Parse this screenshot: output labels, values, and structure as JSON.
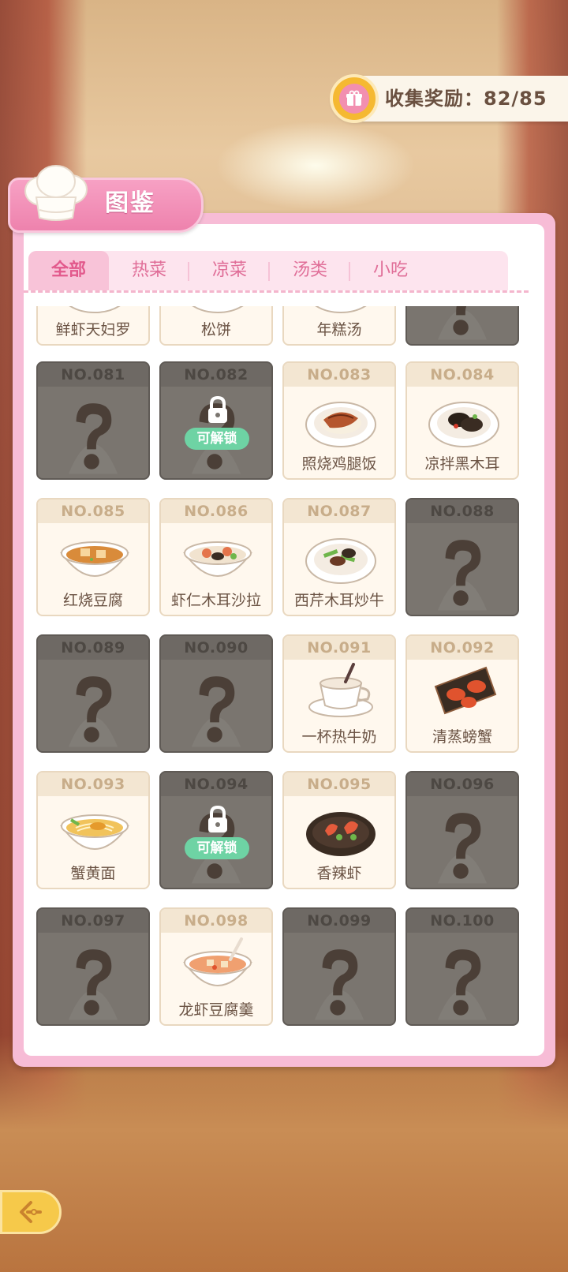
{
  "reward": {
    "label": "收集奖励：82/85",
    "icon": "gift-icon"
  },
  "title": "图鉴",
  "tabs": [
    "全部",
    "热菜",
    "凉菜",
    "汤类",
    "小吃"
  ],
  "active_tab": "全部",
  "top_row": [
    {
      "name": "鲜虾天妇罗",
      "locked": false
    },
    {
      "name": "松饼",
      "locked": false
    },
    {
      "name": "年糕汤",
      "locked": false
    },
    {
      "name": "",
      "locked": true
    }
  ],
  "cards": [
    {
      "no": "NO.081",
      "name": "",
      "locked": true,
      "unlockable": false
    },
    {
      "no": "NO.082",
      "name": "",
      "locked": true,
      "unlockable": true,
      "badge": "可解锁"
    },
    {
      "no": "NO.083",
      "name": "照烧鸡腿饭",
      "locked": false,
      "dish": "chicken-rice"
    },
    {
      "no": "NO.084",
      "name": "凉拌黑木耳",
      "locked": false,
      "dish": "fungus"
    },
    {
      "no": "NO.085",
      "name": "红烧豆腐",
      "locked": false,
      "dish": "tofu"
    },
    {
      "no": "NO.086",
      "name": "虾仁木耳沙拉",
      "locked": false,
      "dish": "salad"
    },
    {
      "no": "NO.087",
      "name": "西芹木耳炒牛",
      "locked": false,
      "dish": "beef"
    },
    {
      "no": "NO.088",
      "name": "",
      "locked": true,
      "unlockable": false
    },
    {
      "no": "NO.089",
      "name": "",
      "locked": true,
      "unlockable": false
    },
    {
      "no": "NO.090",
      "name": "",
      "locked": true,
      "unlockable": false
    },
    {
      "no": "NO.091",
      "name": "一杯热牛奶",
      "locked": false,
      "dish": "milk"
    },
    {
      "no": "NO.092",
      "name": "清蒸螃蟹",
      "locked": false,
      "dish": "crab"
    },
    {
      "no": "NO.093",
      "name": "蟹黄面",
      "locked": false,
      "dish": "noodle"
    },
    {
      "no": "NO.094",
      "name": "",
      "locked": true,
      "unlockable": true,
      "badge": "可解锁"
    },
    {
      "no": "NO.095",
      "name": "香辣虾",
      "locked": false,
      "dish": "shrimp"
    },
    {
      "no": "NO.096",
      "name": "",
      "locked": true,
      "unlockable": false
    },
    {
      "no": "NO.097",
      "name": "",
      "locked": true,
      "unlockable": false
    },
    {
      "no": "NO.098",
      "name": "龙虾豆腐羹",
      "locked": false,
      "dish": "soup"
    },
    {
      "no": "NO.099",
      "name": "",
      "locked": true,
      "unlockable": false
    },
    {
      "no": "NO.100",
      "name": "",
      "locked": true,
      "unlockable": false
    }
  ],
  "colors": {
    "panel_pink": "#f7bcd6",
    "accent": "#e2598c",
    "locked": "#7a756f",
    "badge": "#6ed3a4"
  },
  "back_button": {
    "icon": "back-arrow-icon"
  }
}
